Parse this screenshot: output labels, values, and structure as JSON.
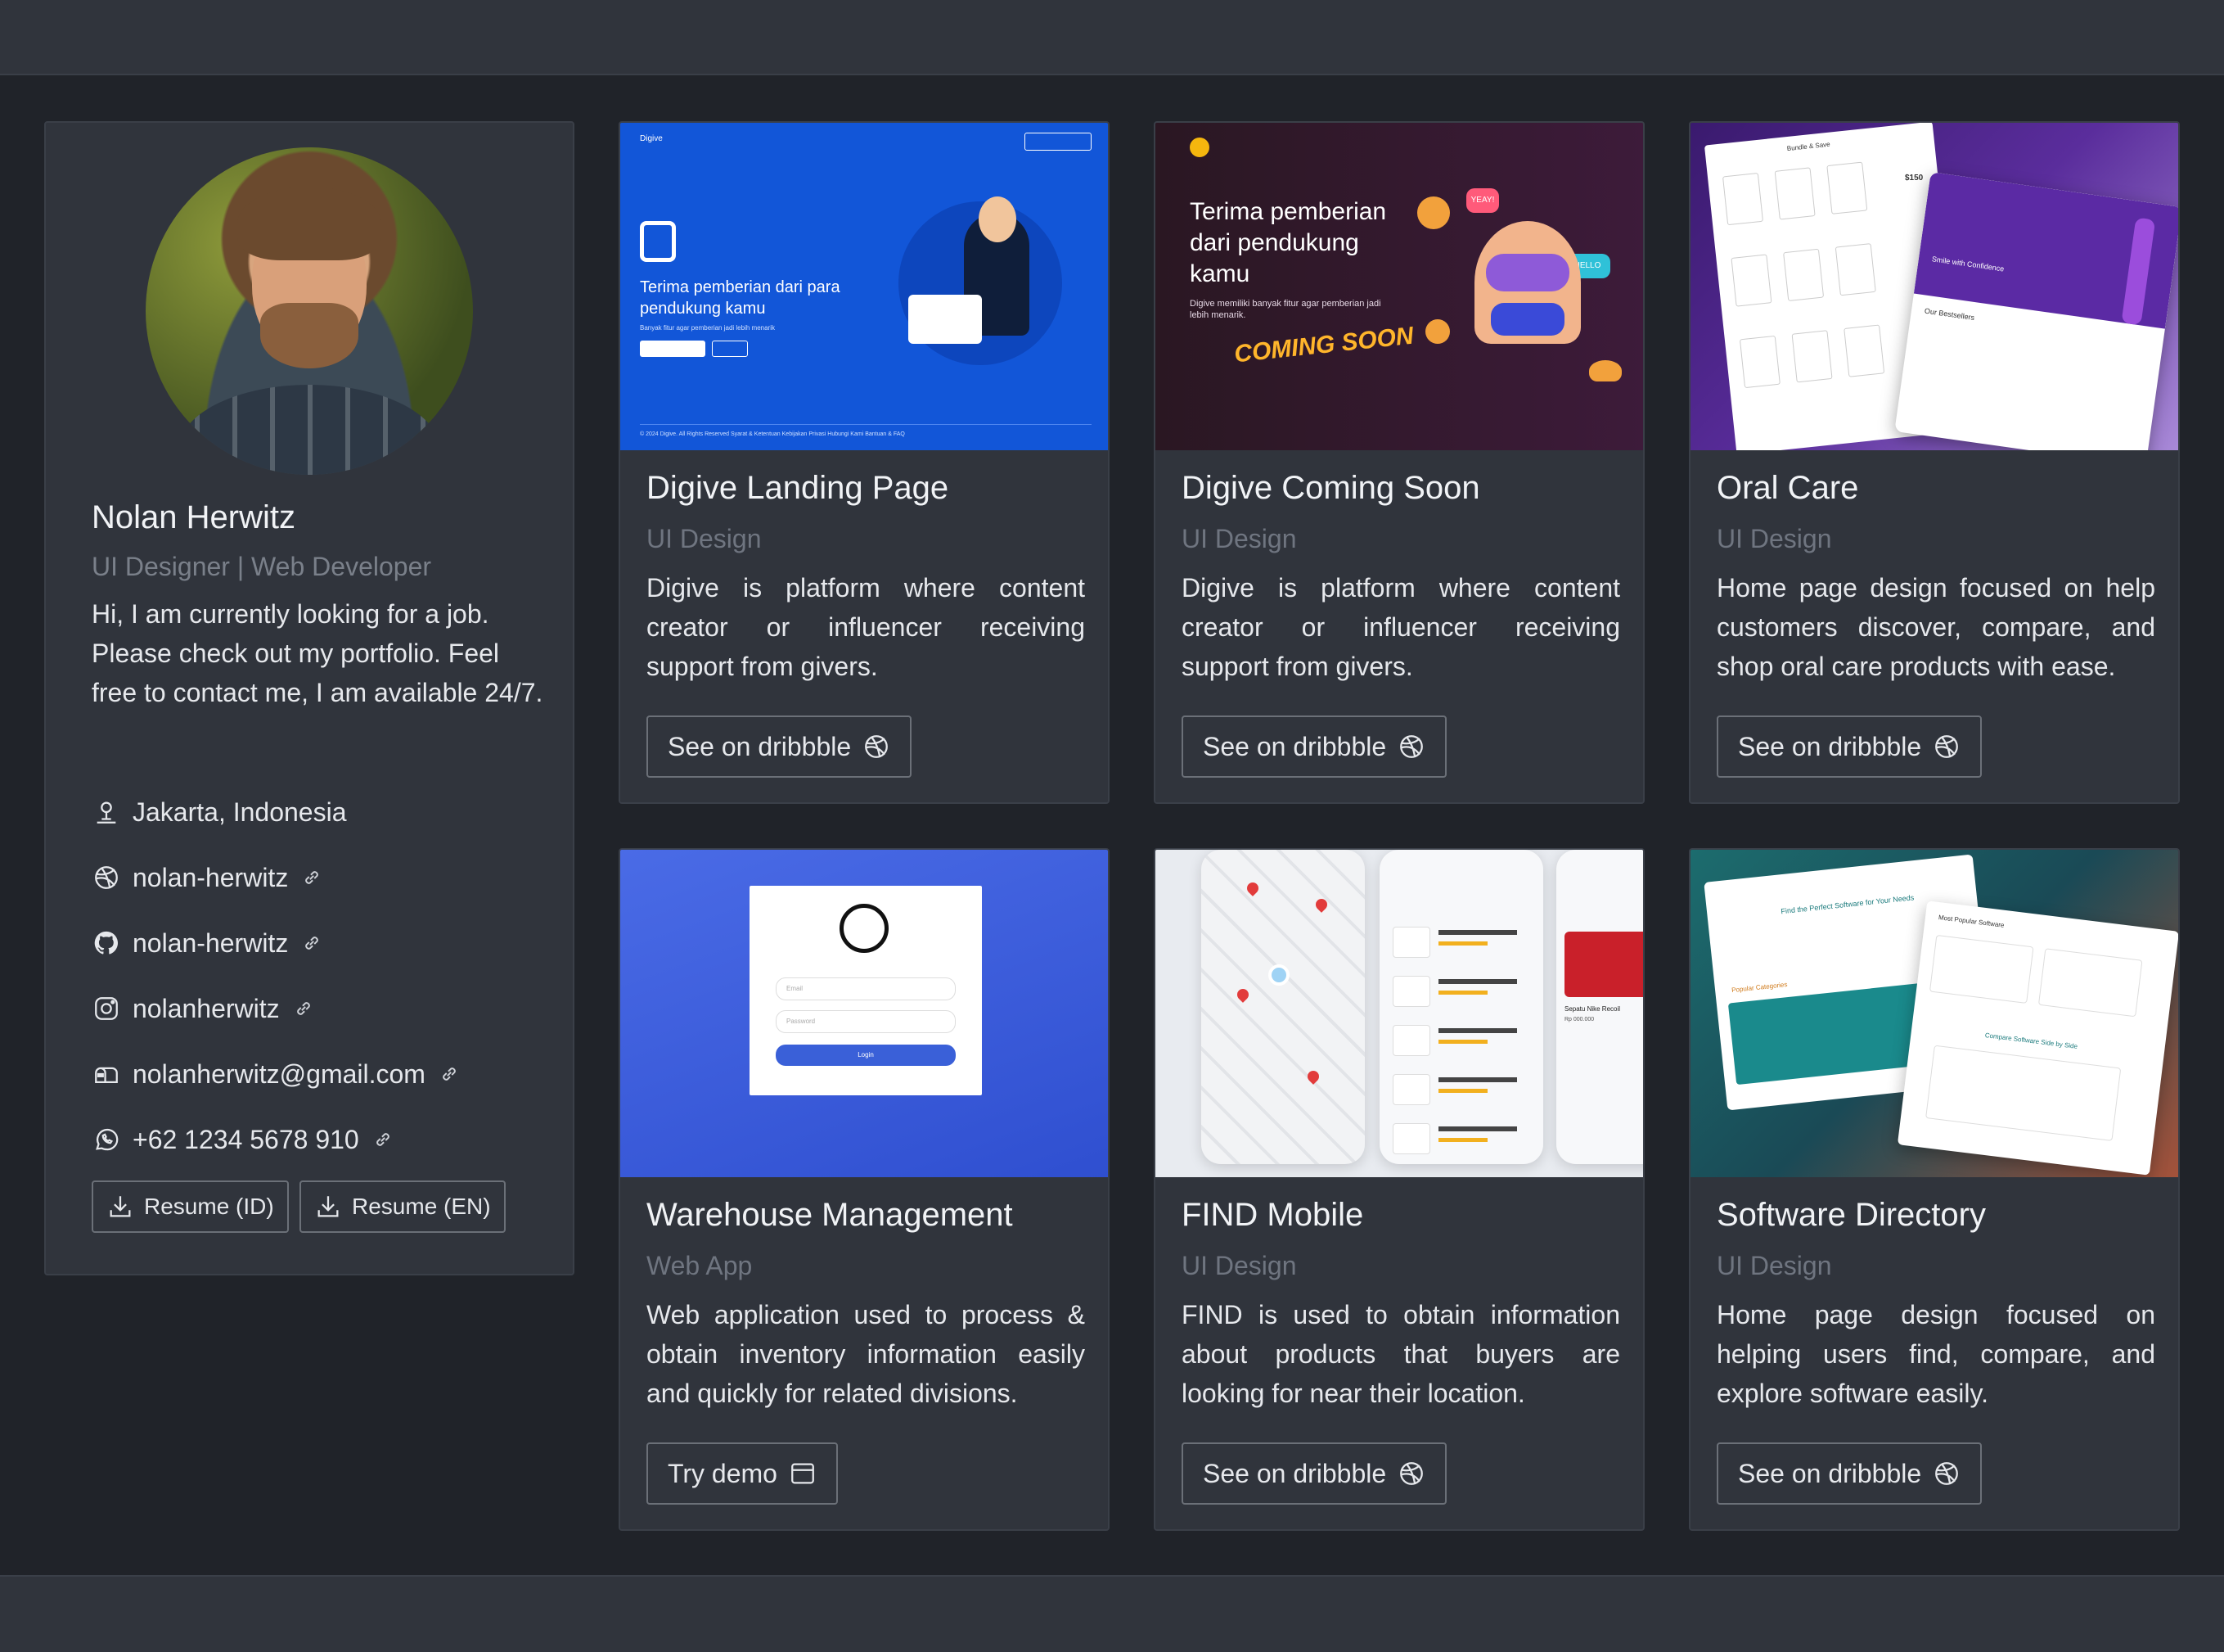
{
  "profile": {
    "name": "Nolan Herwitz",
    "role": "UI Designer | Web Developer",
    "bio": "Hi, I am currently looking for a job. Please check out my portfolio. Feel free to contact me, I am available 24/7.",
    "contacts": {
      "location": "Jakarta, Indonesia",
      "dribbble": "nolan-herwitz",
      "github": "nolan-herwitz",
      "instagram": "nolanherwitz",
      "email": "nolanherwitz@gmail.com",
      "phone": "+62 1234 5678 910"
    },
    "resume_id_label": "Resume (ID)",
    "resume_en_label": "Resume (EN)"
  },
  "projects": [
    {
      "title": "Digive Landing Page",
      "category": "UI Design",
      "description": "Digive is platform where content creator or influencer receiving support from givers.",
      "action": "See on dribbble",
      "action_icon": "dribbble-icon",
      "thumb": {
        "brand": "Digive",
        "nav": "Masuk   Daftar",
        "heading": "Terima pemberian dari para pendukung kamu",
        "sub": "Banyak fitur agar pemberian jadi lebih menarik",
        "btn1": "Daftar sekarang",
        "btn2": "Masuk",
        "footer": "© 2024 Digive. All Rights Reserved   Syarat & Ketentuan   Kebijakan Privasi   Hubungi Kami   Bantuan & FAQ"
      }
    },
    {
      "title": "Digive Coming Soon",
      "category": "UI Design",
      "description": "Digive is platform where content creator or influencer receiving support from givers.",
      "action": "See on dribbble",
      "action_icon": "dribbble-icon",
      "thumb": {
        "heading": "Terima pemberian dari pendukung kamu",
        "sub": "Digive memiliki banyak fitur agar pemberian jadi lebih menarik.",
        "badge": "COMING SOON",
        "bubble1": "YEAY!",
        "bubble2": "HELLO"
      }
    },
    {
      "title": "Oral Care",
      "category": "UI Design",
      "description": "Home page design focused on help customers discover, compare, and shop oral care products with ease.",
      "action": "See on dribbble",
      "action_icon": "dribbble-icon",
      "thumb": {
        "label1": "Bundle & Save",
        "label2": "Smile with Confidence",
        "label3": "Our Bestsellers",
        "price": "$150"
      }
    },
    {
      "title": "Warehouse Management",
      "category": "Web App",
      "description": "Web application used to process & obtain inventory information easily and quickly for related divisions.",
      "action": "Try demo",
      "action_icon": "browser-window-icon",
      "thumb": {
        "email_placeholder": "Email",
        "password_placeholder": "Password",
        "login": "Login"
      }
    },
    {
      "title": "FIND Mobile",
      "category": "UI Design",
      "description": "FIND is used to obtain information about products that buyers are looking for near their location.",
      "action": "See on dribbble",
      "action_icon": "dribbble-icon",
      "thumb": {
        "item_title": "Sepatu Nike Recoil",
        "price": "Rp 000.000"
      }
    },
    {
      "title": "Software Directory",
      "category": "UI Design",
      "description": "Home page design focused on helping users find, compare, and explore software easily.",
      "action": "See on dribbble",
      "action_icon": "dribbble-icon",
      "thumb": {
        "heading": "Find the Perfect Software for Your Needs",
        "popular": "Most Popular Software",
        "categories": "Popular Categories",
        "compare": "Compare Software Side by Side"
      }
    }
  ],
  "colors": {
    "page_bg": "#202329",
    "panel_bg": "#30343c",
    "border": "#3a3f48",
    "muted_text": "#7a808a"
  }
}
